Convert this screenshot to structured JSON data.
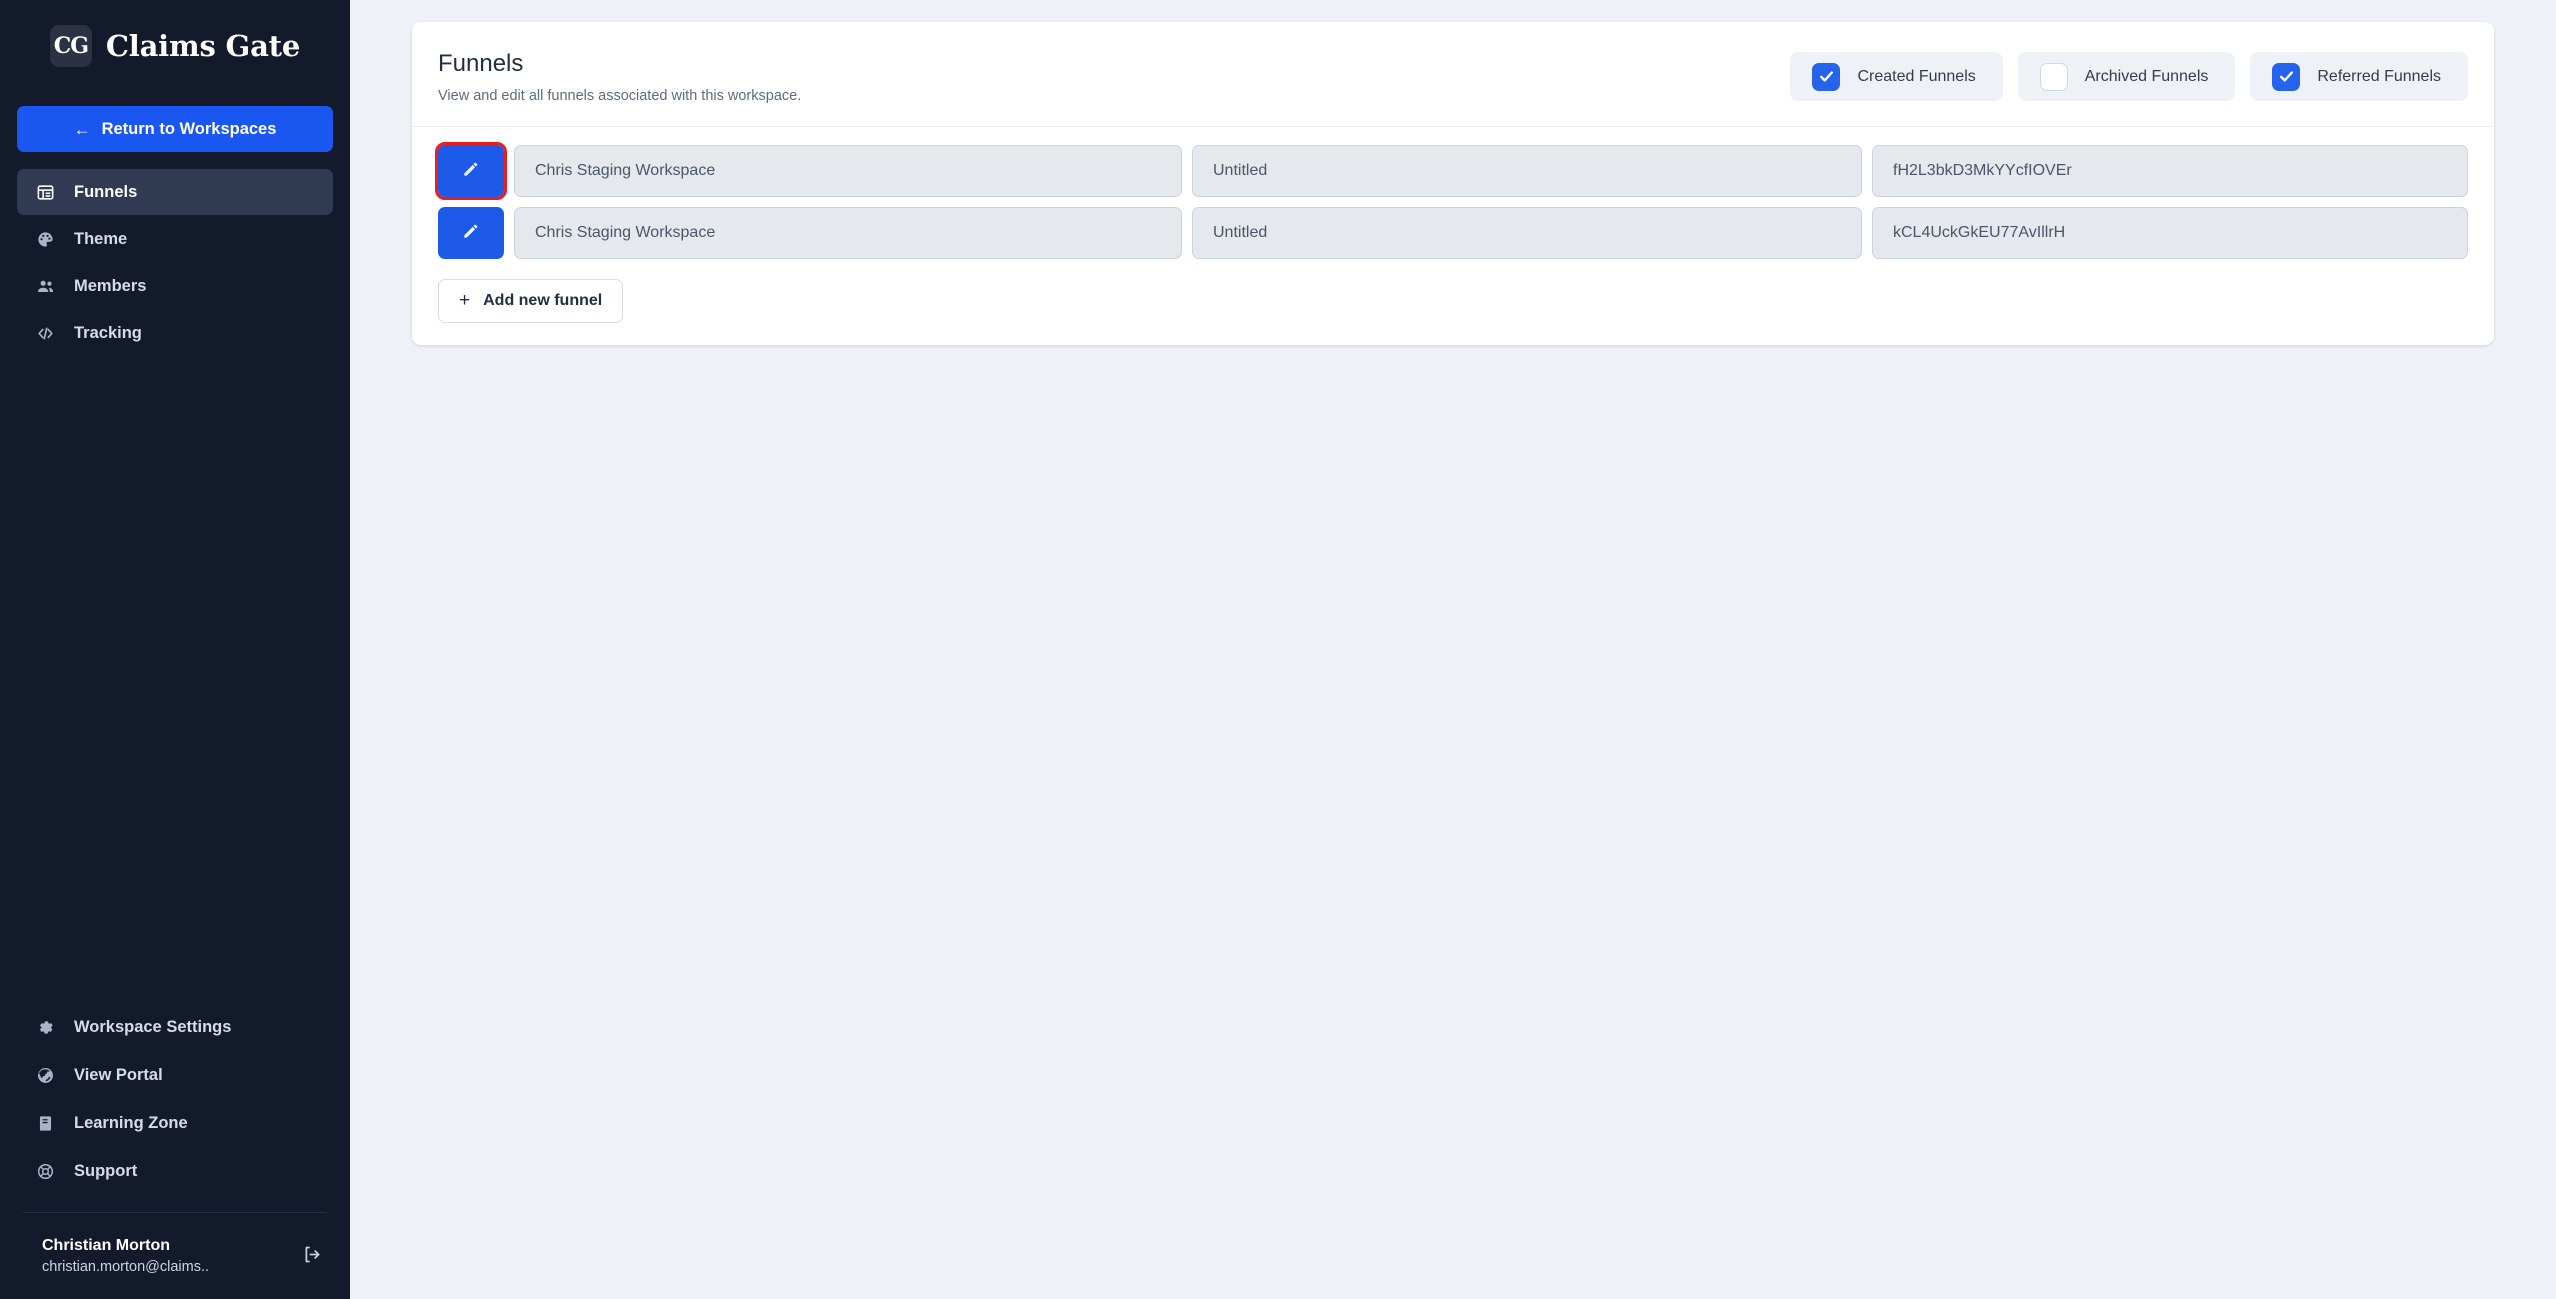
{
  "brand": {
    "mark": "CG",
    "name": "Claims Gate",
    "mark_icon": "claims-gate-logo-icon"
  },
  "sidebar": {
    "return_button": {
      "label": "Return to Workspaces",
      "arrow": "←"
    },
    "primary_items": [
      {
        "label": "Funnels",
        "icon": "table-list-icon",
        "active": true
      },
      {
        "label": "Theme",
        "icon": "palette-icon",
        "active": false
      },
      {
        "label": "Members",
        "icon": "users-icon",
        "active": false
      },
      {
        "label": "Tracking",
        "icon": "code-brackets-icon",
        "active": false
      }
    ],
    "secondary_items": [
      {
        "label": "Workspace Settings",
        "icon": "gear-icon"
      },
      {
        "label": "View Portal",
        "icon": "globe-icon"
      },
      {
        "label": "Learning Zone",
        "icon": "book-icon"
      },
      {
        "label": "Support",
        "icon": "lifebuoy-icon"
      }
    ],
    "user": {
      "name": "Christian Morton",
      "email": "christian.morton@claims..",
      "logout_icon": "logout-icon"
    }
  },
  "main": {
    "header": {
      "title": "Funnels",
      "subtitle": "View and edit all funnels associated with this workspace."
    },
    "filters": [
      {
        "label": "Created Funnels",
        "checked": true
      },
      {
        "label": "Archived Funnels",
        "checked": false
      },
      {
        "label": "Referred Funnels",
        "checked": true
      }
    ],
    "rows": [
      {
        "workspace": "Chris Staging Workspace",
        "name": "Untitled",
        "funnel_id": "fH2L3bkD3MkYYcfIOVEr",
        "edit_icon": "pencil-icon",
        "highlighted": true
      },
      {
        "workspace": "Chris Staging Workspace",
        "name": "Untitled",
        "funnel_id": "kCL4UckGkEU77AvIllrH",
        "edit_icon": "pencil-icon",
        "highlighted": false
      }
    ],
    "add_button": {
      "label": "Add new funnel",
      "plus": "+"
    }
  },
  "colors": {
    "sidebar_bg": "#131a2b",
    "sidebar_active": "#303a52",
    "accent_blue": "#1a56f0",
    "edit_blue": "#1d5ae8",
    "checkbox_blue": "#2563eb",
    "highlight_red": "#f01b1b",
    "page_bg": "#eef1f6",
    "field_bg": "#e5e9ee"
  }
}
